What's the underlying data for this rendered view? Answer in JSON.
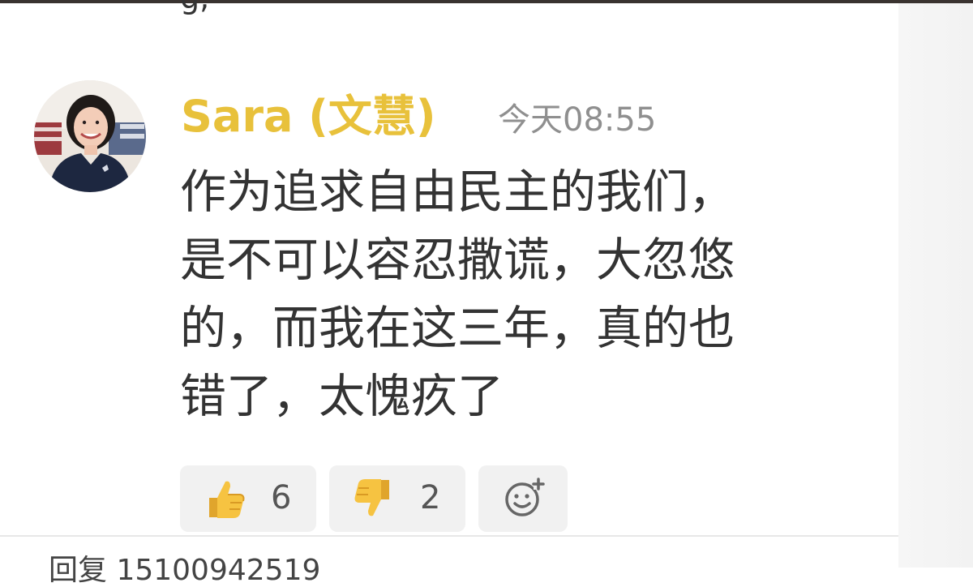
{
  "top_cutoff_text": "g,",
  "comment": {
    "author": "Sara (文慧)",
    "timestamp": "今天08:55",
    "text_lines": [
      "作为追求自由民主的我们，",
      "是不可以容忍撒谎，大忽悠",
      "的，而我在这三年，真的也",
      "错了，太愧疚了"
    ],
    "reactions": {
      "like_count": "6",
      "dislike_count": "2",
      "like_icon": "thumbs-up-icon",
      "dislike_icon": "thumbs-down-icon",
      "add_icon": "add-reaction-icon"
    }
  },
  "bottom_cutoff_text": "回复 15100942519",
  "colors": {
    "author": "#e8c13b",
    "timestamp": "#8f8f8f",
    "text": "#333333",
    "reaction_bg": "#f1f1f1"
  }
}
